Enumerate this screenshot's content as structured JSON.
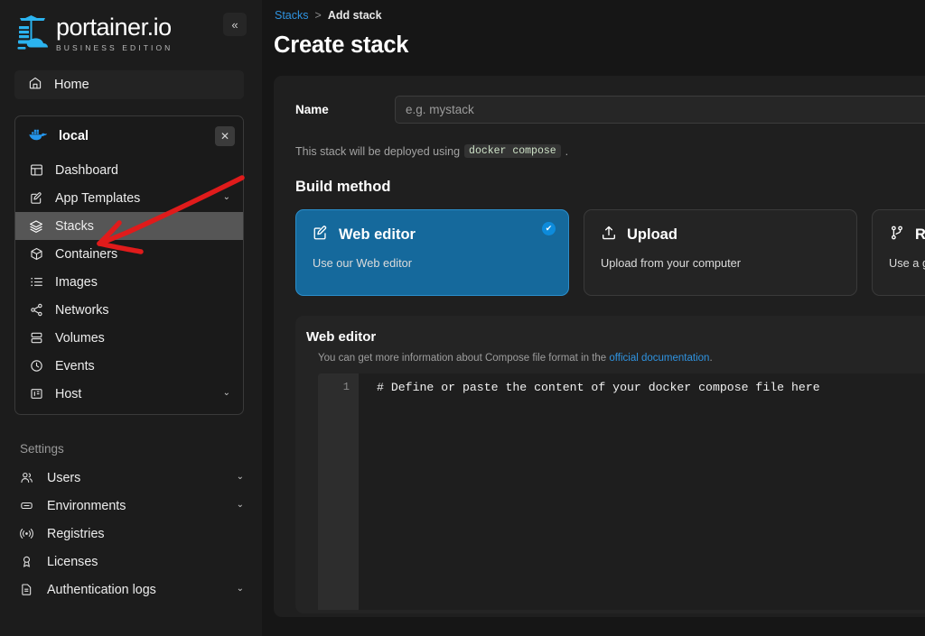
{
  "brand": {
    "name": "portainer.io",
    "edition": "BUSINESS EDITION",
    "logo_icon": "portainer-crane-icon",
    "collapse_icon": "«"
  },
  "sidebar": {
    "home": {
      "label": "Home",
      "icon": "home-icon"
    },
    "environment": {
      "name": "local",
      "icon": "docker-whale-icon",
      "close_label": "✕",
      "items": [
        {
          "label": "Dashboard",
          "icon": "dashboard-icon",
          "chevron": "",
          "active": false
        },
        {
          "label": "App Templates",
          "icon": "template-edit-icon",
          "chevron": "⌄",
          "active": false
        },
        {
          "label": "Stacks",
          "icon": "stacks-layers-icon",
          "chevron": "",
          "active": true
        },
        {
          "label": "Containers",
          "icon": "container-box-icon",
          "chevron": "",
          "active": false
        },
        {
          "label": "Images",
          "icon": "images-list-icon",
          "chevron": "",
          "active": false
        },
        {
          "label": "Networks",
          "icon": "networks-share-icon",
          "chevron": "",
          "active": false
        },
        {
          "label": "Volumes",
          "icon": "volumes-database-icon",
          "chevron": "",
          "active": false
        },
        {
          "label": "Events",
          "icon": "events-clock-icon",
          "chevron": "",
          "active": false
        },
        {
          "label": "Host",
          "icon": "host-server-icon",
          "chevron": "⌄",
          "active": false
        }
      ]
    },
    "settings": {
      "title": "Settings",
      "items": [
        {
          "label": "Users",
          "icon": "users-icon",
          "chevron": "⌄"
        },
        {
          "label": "Environments",
          "icon": "environments-icon",
          "chevron": "⌄"
        },
        {
          "label": "Registries",
          "icon": "registries-broadcast-icon",
          "chevron": ""
        },
        {
          "label": "Licenses",
          "icon": "licenses-award-icon",
          "chevron": ""
        },
        {
          "label": "Authentication logs",
          "icon": "auth-logs-file-icon",
          "chevron": "⌄"
        }
      ]
    }
  },
  "breadcrumb": {
    "parent": "Stacks",
    "separator": ">",
    "current": "Add stack"
  },
  "page": {
    "title": "Create stack"
  },
  "form": {
    "name_label": "Name",
    "name_placeholder": "e.g. mystack",
    "name_value": "",
    "hint_prefix": "This stack will be deployed using",
    "hint_code": "docker compose",
    "hint_suffix": "."
  },
  "build_method": {
    "title": "Build method",
    "cards": [
      {
        "title": "Web editor",
        "desc": "Use our Web editor",
        "icon": "pencil-square-icon",
        "selected": true,
        "check": "✔"
      },
      {
        "title": "Upload",
        "desc": "Upload from your computer",
        "icon": "upload-arrow-icon",
        "selected": false,
        "check": ""
      },
      {
        "title": "Repository",
        "desc": "Use a git repository",
        "icon": "git-branch-icon",
        "selected": false,
        "check": ""
      }
    ]
  },
  "web_editor": {
    "title": "Web editor",
    "hint_prefix": "You can get more information about Compose file format in the",
    "hint_link": "official documentation",
    "hint_suffix": ".",
    "line_number": "1",
    "code": "# Define or paste the content of your docker compose file here"
  },
  "annotation": {
    "type": "red-arrow",
    "points_to": "Stacks",
    "color": "#e01b1b"
  },
  "colors": {
    "accent_blue": "#2f93e0",
    "selected_card": "#15699c",
    "check_badge": "#0d8bdb",
    "page_bg": "#161616",
    "sidebar_bg": "#1c1c1c",
    "annotation_red": "#e01b1b"
  }
}
